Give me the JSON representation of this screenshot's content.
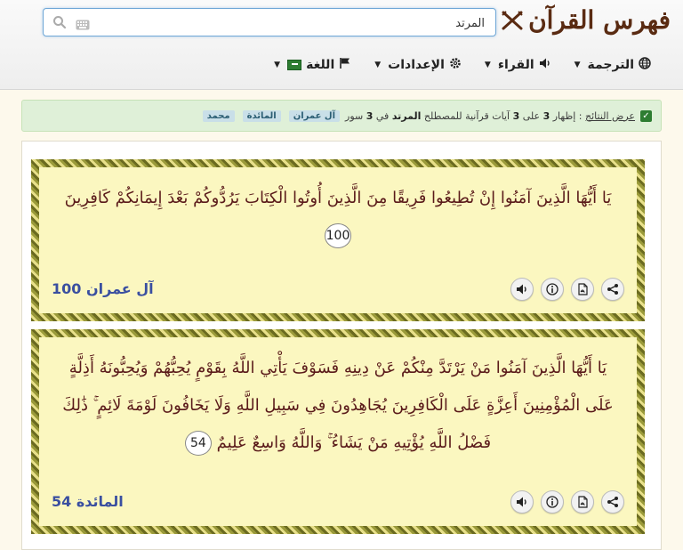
{
  "header": {
    "brand": "فهرس القرآن",
    "search": {
      "value": "المرتد",
      "placeholder": ""
    }
  },
  "nav": {
    "items": [
      {
        "label": "الترجمة",
        "icon": "globe-icon"
      },
      {
        "label": "القراء",
        "icon": "speaker-icon"
      },
      {
        "label": "الإعدادات",
        "icon": "gear-icon"
      },
      {
        "label": "اللغة",
        "icon": "flag-icon"
      }
    ]
  },
  "banner": {
    "link": "عرض النتائج",
    "sep": " : ",
    "t1": "إظهار ",
    "n1": "3",
    "t2": " على ",
    "n2": "3",
    "t3": " آيات قرآنية للمصطلح ",
    "term": "المرتد",
    "t4": " في ",
    "n3": "3",
    "t5": " سور",
    "chips": [
      "آل عمران",
      "المائدة",
      "محمد"
    ]
  },
  "verses": [
    {
      "text": "يَا أَيُّهَا الَّذِينَ آمَنُوا إِنْ تُطِيعُوا فَرِيقًا مِنَ الَّذِينَ أُوتُوا الْكِتَابَ يَرُدُّوكُمْ بَعْدَ إِيمَانِكُمْ كَافِرِينَ",
      "number": "100",
      "ref": "آل عمران 100"
    },
    {
      "text": "يَا أَيُّهَا الَّذِينَ آمَنُوا مَنْ يَرْتَدَّ مِنْكُمْ عَنْ دِينِهِ فَسَوْفَ يَأْتِي اللَّهُ بِقَوْمٍ يُحِبُّهُمْ وَيُحِبُّونَهُ أَذِلَّةٍ عَلَى الْمُؤْمِنِينَ أَعِزَّةٍ عَلَى الْكَافِرِينَ يُجَاهِدُونَ فِي سَبِيلِ اللَّهِ وَلَا يَخَافُونَ لَوْمَةَ لَائِمٍ ۚ ذَٰلِكَ فَضْلُ اللَّهِ يُؤْتِيهِ مَنْ يَشَاءُ ۚ وَاللَّهُ وَاسِعٌ عَلِيمٌ",
      "number": "54",
      "ref": "المائدة 54"
    }
  ],
  "action_icons": [
    "audio-icon",
    "info-icon",
    "pdf-icon",
    "share-icon"
  ]
}
